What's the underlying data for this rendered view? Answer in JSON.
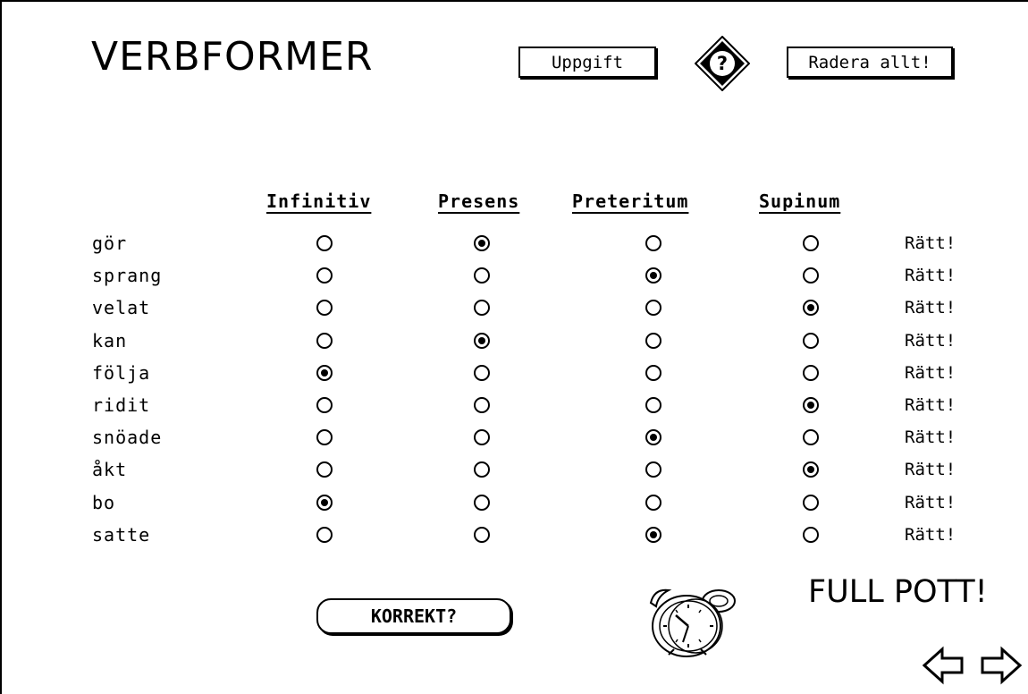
{
  "title": "VERBFORMER",
  "toolbar": {
    "uppgift_label": "Uppgift",
    "radera_label": "Radera allt!",
    "help_icon": "question-diamond-icon"
  },
  "columns": [
    "Infinitiv",
    "Presens",
    "Preteritum",
    "Supinum"
  ],
  "rows": [
    {
      "word": "gör",
      "selected": 1,
      "status": "Rätt!"
    },
    {
      "word": "sprang",
      "selected": 2,
      "status": "Rätt!"
    },
    {
      "word": "velat",
      "selected": 3,
      "status": "Rätt!"
    },
    {
      "word": "kan",
      "selected": 1,
      "status": "Rätt!"
    },
    {
      "word": "följa",
      "selected": 0,
      "status": "Rätt!"
    },
    {
      "word": "ridit",
      "selected": 3,
      "status": "Rätt!"
    },
    {
      "word": "snöade",
      "selected": 2,
      "status": "Rätt!"
    },
    {
      "word": "åkt",
      "selected": 3,
      "status": "Rätt!"
    },
    {
      "word": "bo",
      "selected": 0,
      "status": "Rätt!"
    },
    {
      "word": "satte",
      "selected": 2,
      "status": "Rätt!"
    }
  ],
  "korrekt_label": "KORREKT?",
  "result": "FULL POTT!",
  "icons": {
    "timer": "alarm-clock-icon",
    "previous": "arrow-left-icon",
    "next": "arrow-right-icon"
  }
}
